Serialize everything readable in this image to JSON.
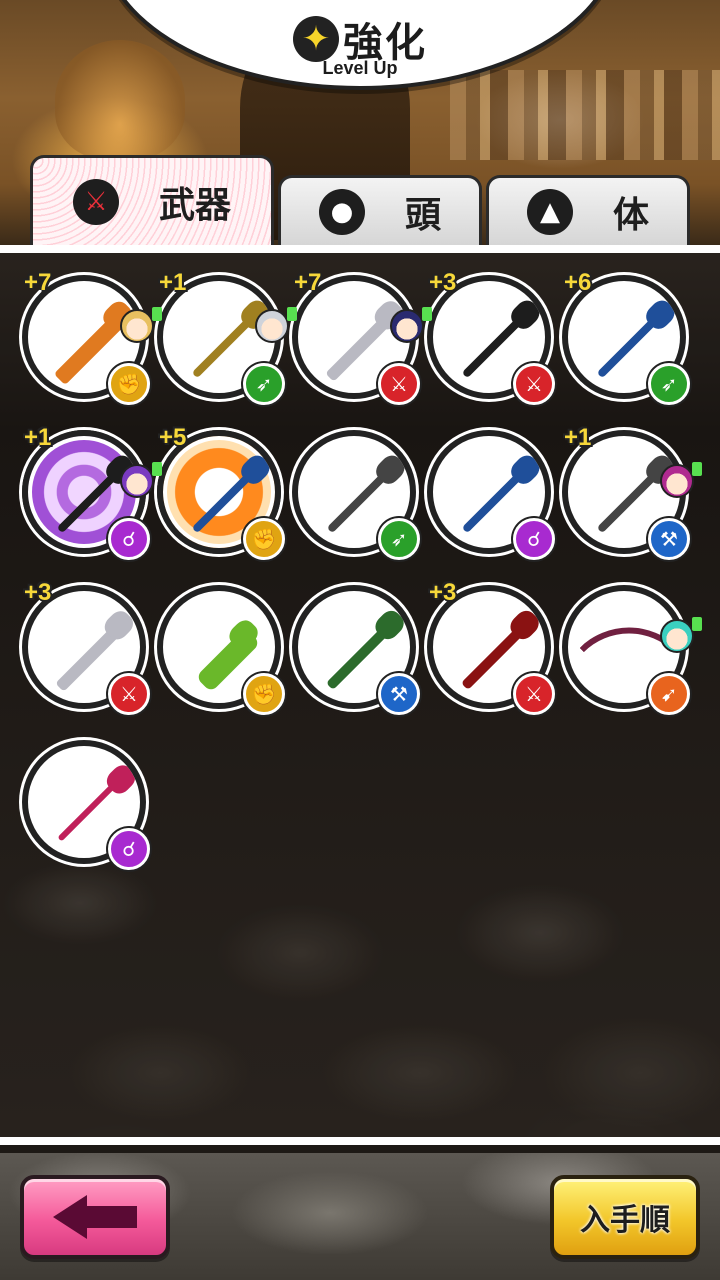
{
  "header": {
    "title": "強化",
    "subtitle": "Level Up",
    "title_icon": "sparkle-icon"
  },
  "tabs": [
    {
      "label": "武器",
      "icon": "sword-icon",
      "active": true
    },
    {
      "label": "頭",
      "icon": "head-icon",
      "active": false
    },
    {
      "label": "体",
      "icon": "body-icon",
      "active": false
    }
  ],
  "items": [
    {
      "plus": "+7",
      "weapon": "pumpkin-staff",
      "type": "fist",
      "character": "blonde"
    },
    {
      "plus": "+1",
      "weapon": "floral-spear",
      "type": "spear",
      "character": "silver"
    },
    {
      "plus": "+7",
      "weapon": "halloween-sword",
      "type": "sword",
      "character": "navy"
    },
    {
      "plus": "+3",
      "weapon": "katana",
      "type": "sword",
      "character": ""
    },
    {
      "plus": "+6",
      "weapon": "broom-spear",
      "type": "spear",
      "character": ""
    },
    {
      "plus": "+1",
      "weapon": "ornate-staff",
      "type": "staff",
      "character": "purple"
    },
    {
      "plus": "+5",
      "weapon": "dragon-gauntlet",
      "type": "fist",
      "character": ""
    },
    {
      "plus": "",
      "weapon": "halberd",
      "type": "spear",
      "character": ""
    },
    {
      "plus": "",
      "weapon": "crystal-staff",
      "type": "staff",
      "character": ""
    },
    {
      "plus": "+1",
      "weapon": "battle-axe",
      "type": "axe",
      "character": "magenta"
    },
    {
      "plus": "+3",
      "weapon": "broadsword",
      "type": "sword",
      "character": ""
    },
    {
      "plus": "",
      "weapon": "claw",
      "type": "fist",
      "character": ""
    },
    {
      "plus": "",
      "weapon": "green-greatsword",
      "type": "axe",
      "character": ""
    },
    {
      "plus": "+3",
      "weapon": "crimson-blade",
      "type": "sword",
      "character": ""
    },
    {
      "plus": "",
      "weapon": "dark-bow",
      "type": "bow",
      "character": "teal"
    },
    {
      "plus": "",
      "weapon": "pink-staff",
      "type": "staff",
      "character": ""
    }
  ],
  "footer": {
    "back_icon": "arrow-left-icon",
    "sort_label": "入手順"
  },
  "colors": {
    "fist": "#e0a412",
    "spear": "#2aa02a",
    "sword": "#d8242a",
    "staff": "#a82ad0",
    "axe": "#1e66c8",
    "bow": "#e8641e",
    "plus_text": "#f7d83a",
    "back_button": "#f45a9a",
    "sort_button": "#f2c62a"
  }
}
